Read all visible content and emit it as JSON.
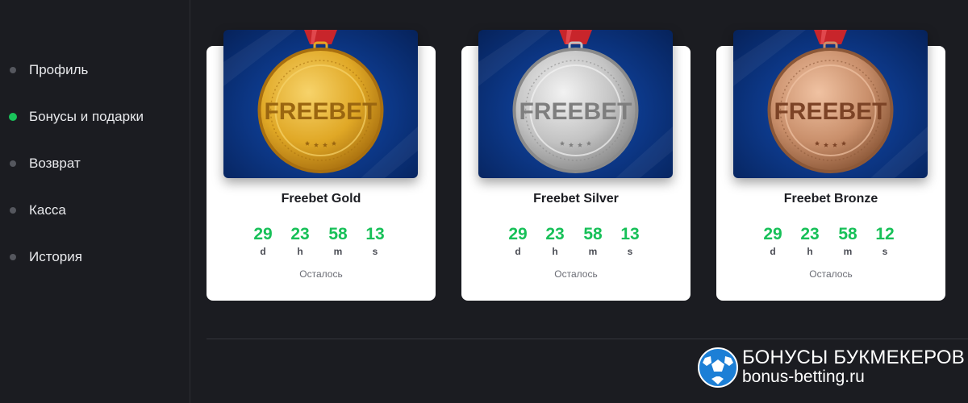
{
  "sidebar": {
    "items": [
      {
        "label": "Профиль"
      },
      {
        "label": "Бонусы и подарки",
        "active": true
      },
      {
        "label": "Возврат"
      },
      {
        "label": "Касса"
      },
      {
        "label": "История"
      }
    ]
  },
  "cards": [
    {
      "image_text": "FREEBET",
      "title": "Freebet Gold",
      "timer": [
        {
          "value": "29",
          "unit": "d"
        },
        {
          "value": "23",
          "unit": "h"
        },
        {
          "value": "58",
          "unit": "m"
        },
        {
          "value": "13",
          "unit": "s"
        }
      ],
      "remaining": "Осталось",
      "medal_colors": {
        "light": "#f7d36a",
        "mid": "#e0a826",
        "dark": "#a9700f",
        "text": "#9a6610"
      }
    },
    {
      "image_text": "FREEBET",
      "title": "Freebet Silver",
      "timer": [
        {
          "value": "29",
          "unit": "d"
        },
        {
          "value": "23",
          "unit": "h"
        },
        {
          "value": "58",
          "unit": "m"
        },
        {
          "value": "13",
          "unit": "s"
        }
      ],
      "remaining": "Осталось",
      "medal_colors": {
        "light": "#f2f2f2",
        "mid": "#c3c3c3",
        "dark": "#8a8a8a",
        "text": "#7e7e7e"
      }
    },
    {
      "image_text": "FREEBET",
      "title": "Freebet Bronze",
      "timer": [
        {
          "value": "29",
          "unit": "d"
        },
        {
          "value": "23",
          "unit": "h"
        },
        {
          "value": "58",
          "unit": "m"
        },
        {
          "value": "12",
          "unit": "s"
        }
      ],
      "remaining": "Осталось",
      "medal_colors": {
        "light": "#f0c2a2",
        "mid": "#c98f6b",
        "dark": "#8c5838",
        "text": "#7c4326"
      }
    }
  ],
  "watermark": {
    "title": "БОНУСЫ БУКМЕКЕРОВ",
    "url": "bonus-betting.ru"
  },
  "colors": {
    "background": "#1b1c21",
    "accent_green": "#19c35a",
    "card": "#ffffff"
  }
}
